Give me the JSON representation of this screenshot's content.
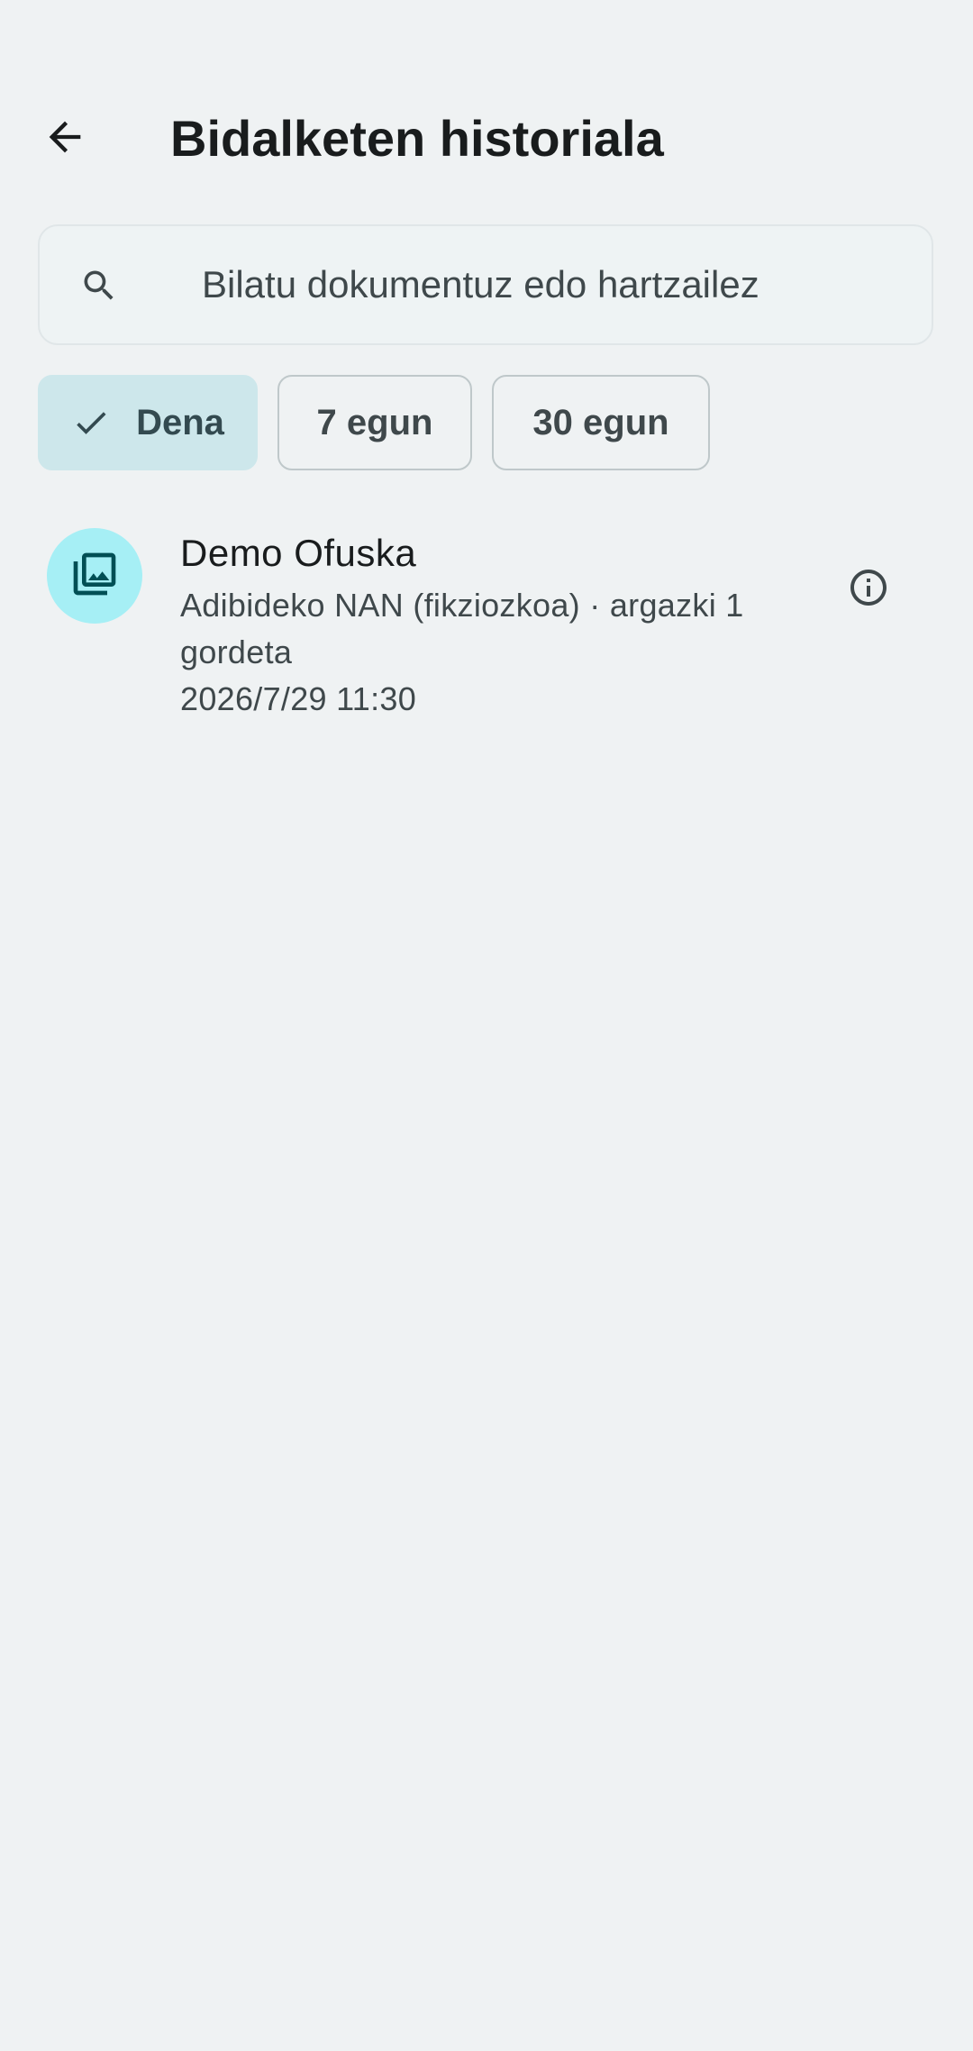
{
  "app_bar": {
    "back_icon": "arrow-back-icon",
    "title": "Bidalketen historiala"
  },
  "search": {
    "icon": "search-icon",
    "placeholder": "Bilatu dokumentuz edo hartzailez",
    "value": ""
  },
  "filters": {
    "chips": [
      {
        "label": "Dena",
        "selected": true,
        "icon": "check-icon"
      },
      {
        "label": "7 egun",
        "selected": false
      },
      {
        "label": "30 egun",
        "selected": false
      }
    ]
  },
  "history": {
    "items": [
      {
        "icon": "photo-library-icon",
        "title": "Demo Ofuska",
        "subtitle": "Adibideko NAN (fikziozkoa) · argazki 1 gordeta",
        "date": "2026/7/29 11:30",
        "action_icon": "info-icon"
      }
    ]
  },
  "colors": {
    "background": "#eff2f3",
    "chip_selected": "#cde7eb",
    "avatar_bg": "#a6eff5",
    "avatar_icon": "#004f55",
    "text_primary": "#191c1d",
    "text_secondary": "#3f484b"
  }
}
